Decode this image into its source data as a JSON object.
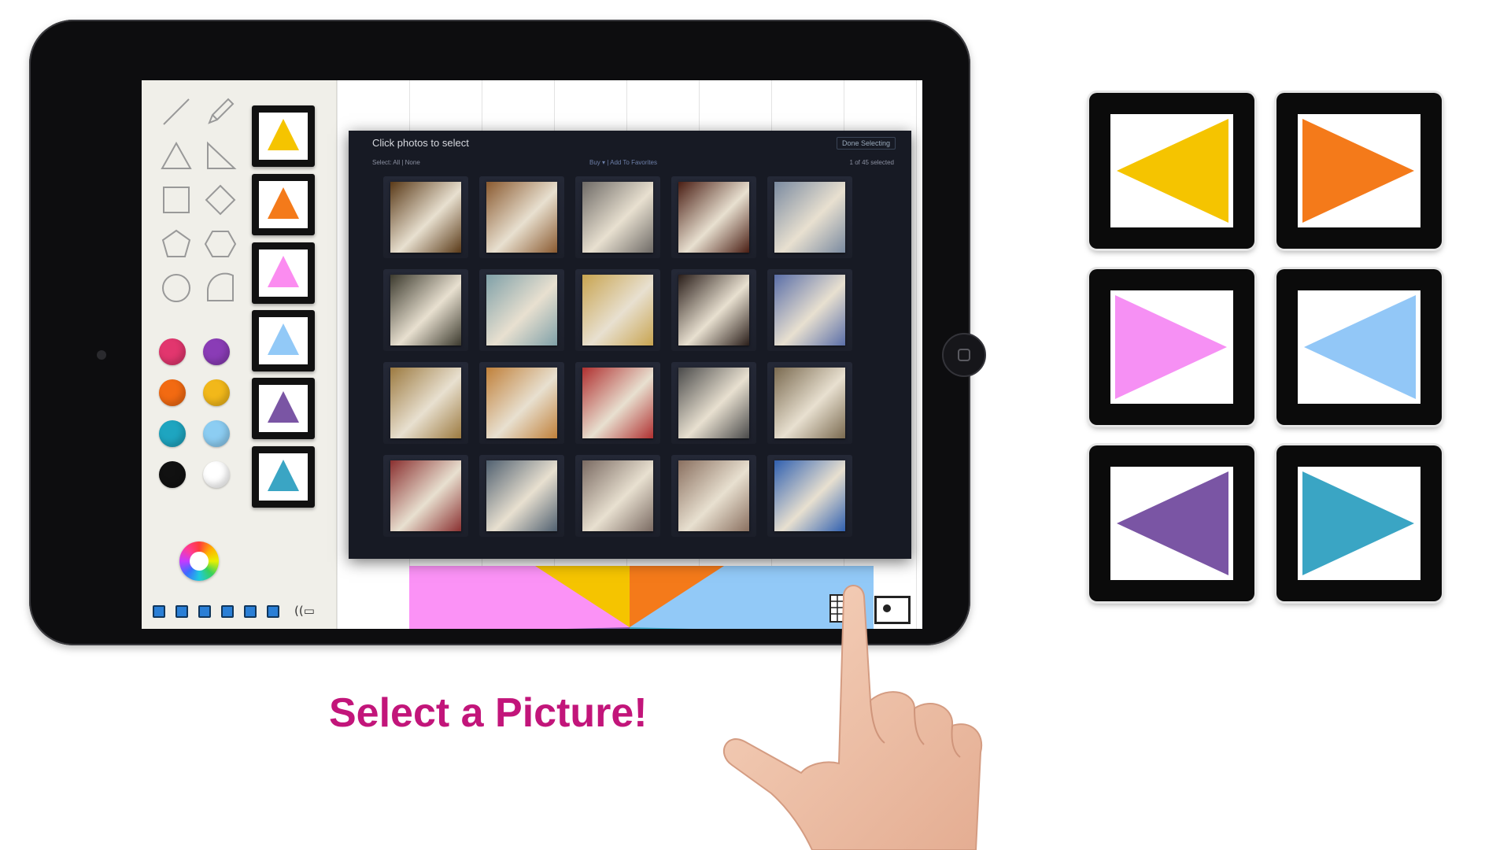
{
  "caption": "Select a Picture!",
  "picker": {
    "title": "Click photos to select",
    "done_label": "Done Selecting",
    "select_text": "Select: All | None",
    "actions_text": "Buy ▾  |  Add To Favorites",
    "count_text": "1 of 45 selected",
    "thumbnails": [
      {
        "color": "#5a3a18"
      },
      {
        "color": "#8a5a30"
      },
      {
        "color": "#6e6a66"
      },
      {
        "color": "#4a1e14"
      },
      {
        "color": "#7a8aa0"
      },
      {
        "color": "#3c3a2e"
      },
      {
        "color": "#7fa0a8"
      },
      {
        "color": "#c8a450"
      },
      {
        "color": "#2a1e1a"
      },
      {
        "color": "#5a6ea8"
      },
      {
        "color": "#9c7a40"
      },
      {
        "color": "#c0803a"
      },
      {
        "color": "#b03030"
      },
      {
        "color": "#4a4a4a"
      },
      {
        "color": "#7a6a50"
      },
      {
        "color": "#8a3030"
      },
      {
        "color": "#506070"
      },
      {
        "color": "#7a6a62"
      },
      {
        "color": "#8a7060"
      },
      {
        "color": "#3060b0"
      }
    ]
  },
  "palette": {
    "swatches": [
      "#e2366e",
      "#8a3cb6",
      "#f26a12",
      "#f2b81a",
      "#1ea5c0",
      "#8ccdf2",
      "#111111",
      "#ffffff"
    ]
  },
  "stamps": [
    "#f5c400",
    "#f47a1a",
    "#fb8cf0",
    "#92c9f7",
    "#7a55a4",
    "#3aa5c4"
  ],
  "cards": [
    {
      "color": "#f5c400",
      "direction": "left"
    },
    {
      "color": "#f47a1a",
      "direction": "right"
    },
    {
      "color": "#f690f4",
      "direction": "right"
    },
    {
      "color": "#92c7f7",
      "direction": "left"
    },
    {
      "color": "#7a55a4",
      "direction": "left"
    },
    {
      "color": "#3aa5c4",
      "direction": "right"
    }
  ]
}
